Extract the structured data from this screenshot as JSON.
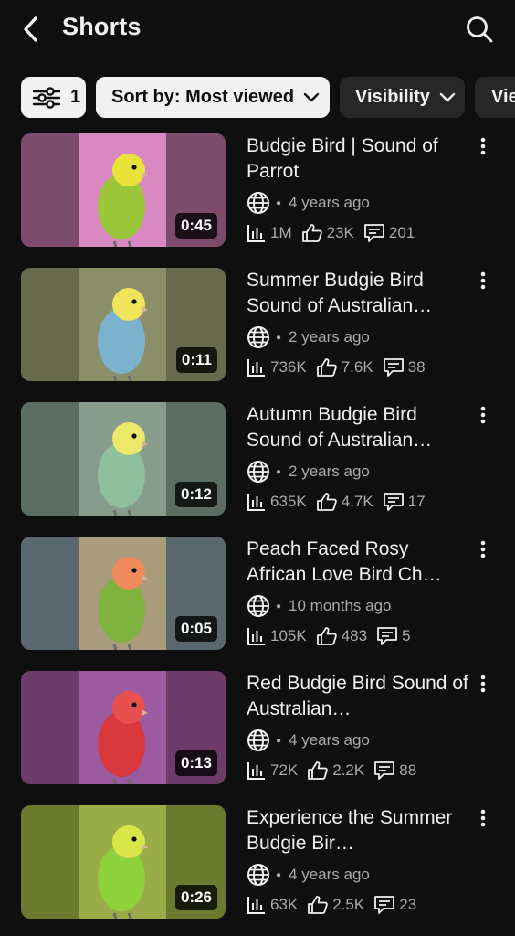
{
  "header": {
    "title": "Shorts",
    "back_icon": "chevron-left-icon",
    "search_icon": "search-icon"
  },
  "chips": {
    "filter_count": "1",
    "sort_label": "Sort by: Most viewed",
    "visibility_label": "Visibility",
    "views_label": "Vie"
  },
  "videos": [
    {
      "title": "Budgie Bird | Sound of Parrot",
      "age": "4 years ago",
      "views": "1M",
      "likes": "23K",
      "comments": "201",
      "duration": "0:45",
      "thumb_bg": "#7d4c6d",
      "frame_bg": "#d989c2",
      "bird": "#9cc63a",
      "bird_head": "#e9e23a"
    },
    {
      "title": "Summer Budgie Bird Sound of Australian…",
      "age": "2 years ago",
      "views": "736K",
      "likes": "7.6K",
      "comments": "38",
      "duration": "0:11",
      "thumb_bg": "#676b4c",
      "frame_bg": "#8a8f6a",
      "bird": "#7bb3cf",
      "bird_head": "#f0e55a"
    },
    {
      "title": "Autumn Budgie Bird Sound of Australian…",
      "age": "2 years ago",
      "views": "635K",
      "likes": "4.7K",
      "comments": "17",
      "duration": "0:12",
      "thumb_bg": "#5c6e63",
      "frame_bg": "#889c8e",
      "bird": "#8fbf9c",
      "bird_head": "#ece86a"
    },
    {
      "title": "Peach Faced Rosy African Love Bird Ch…",
      "age": "10 months ago",
      "views": "105K",
      "likes": "483",
      "comments": "5",
      "duration": "0:05",
      "thumb_bg": "#58686d",
      "frame_bg": "#a89c7c",
      "bird": "#7fb23e",
      "bird_head": "#f08a5c"
    },
    {
      "title": "Red Budgie Bird Sound of Australian…",
      "age": "4 years ago",
      "views": "72K",
      "likes": "2.2K",
      "comments": "88",
      "duration": "0:13",
      "thumb_bg": "#6e3c6a",
      "frame_bg": "#9c5aa0",
      "bird": "#d9383e",
      "bird_head": "#e85050"
    },
    {
      "title": "Experience the Summer Budgie Bir…",
      "age": "4 years ago",
      "views": "63K",
      "likes": "2.5K",
      "comments": "23",
      "duration": "0:26",
      "thumb_bg": "#6b7a2e",
      "frame_bg": "#9aac48",
      "bird": "#8fd13a",
      "bird_head": "#d8e64a"
    }
  ],
  "icons": {
    "public": "globe-icon",
    "views": "bar-chart-icon",
    "likes": "thumbs-up-icon",
    "comments": "comment-icon",
    "more": "more-vertical-icon"
  }
}
